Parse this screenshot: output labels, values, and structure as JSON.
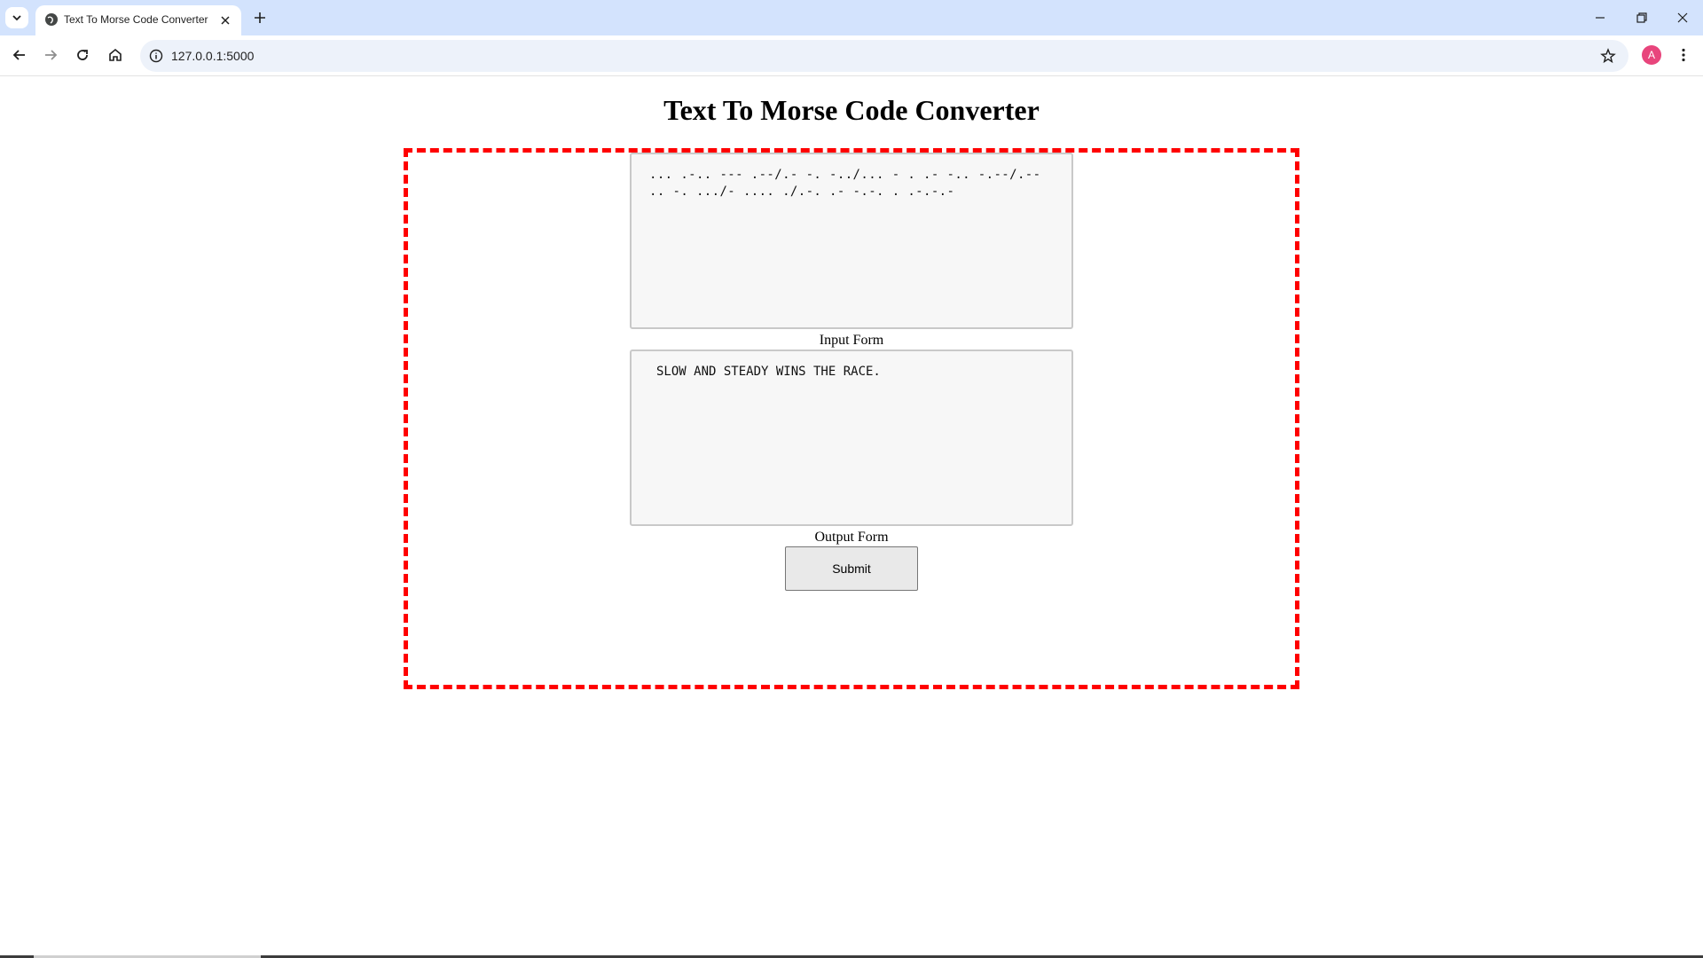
{
  "browser": {
    "tab_title": "Text To Morse Code Converter",
    "url": "127.0.0.1:5000",
    "profile_initial": "A",
    "colors": {
      "tabstrip": "#d3e3fd",
      "omnibox": "#edf2fa",
      "avatar": "#e8457c"
    },
    "icons": [
      "tab-search-icon",
      "globe-icon",
      "close-icon",
      "plus-icon",
      "minimize-icon",
      "restore-icon",
      "close-window-icon",
      "back-icon",
      "forward-icon",
      "reload-icon",
      "home-icon",
      "info-icon",
      "star-icon",
      "kebab-menu-icon"
    ]
  },
  "page": {
    "title": "Text To Morse Code Converter",
    "input_value": "... .-.. --- .--/.- -. -../... - . .- -.. -.--/.-- .. -. .../- .... ./.-. .- -.-. . .-.-.-",
    "input_label": "Input Form",
    "output_value": "SLOW AND STEADY WINS THE RACE.",
    "output_label": "Output Form",
    "submit_label": "Submit",
    "accent_color": "#ff0000"
  }
}
